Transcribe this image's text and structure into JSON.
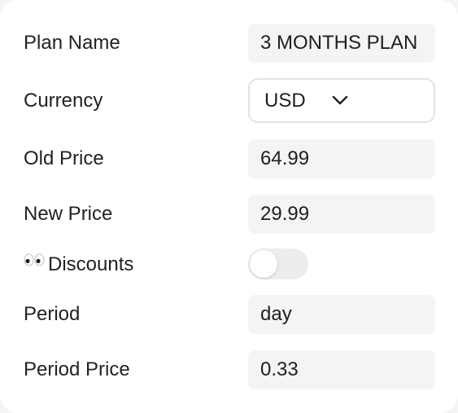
{
  "form": {
    "plan_name": {
      "label": "Plan Name",
      "value": "3 MONTHS PLAN"
    },
    "currency": {
      "label": "Currency",
      "selected": "USD",
      "icon": "chevron-down-icon"
    },
    "old_price": {
      "label": "Old Price",
      "value": "64.99"
    },
    "new_price": {
      "label": "New Price",
      "value": "29.99"
    },
    "discounts": {
      "label": "Discounts",
      "icon": "eyes-emoji-icon",
      "enabled": false
    },
    "period": {
      "label": "Period",
      "value": "day"
    },
    "period_price": {
      "label": "Period Price",
      "value": "0.33"
    }
  }
}
